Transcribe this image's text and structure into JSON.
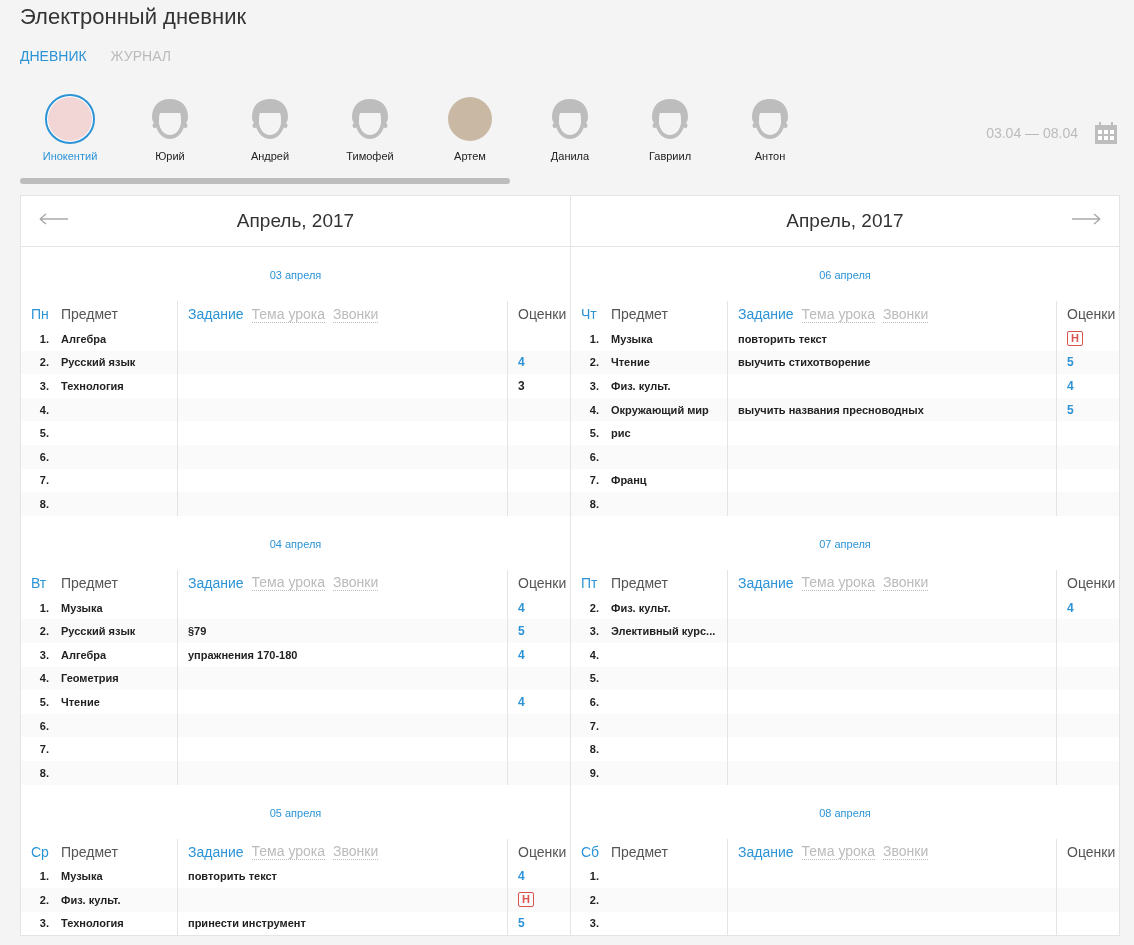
{
  "title": "Электронный дневник",
  "tabs": [
    {
      "label": "ДНЕВНИК",
      "selected": true
    },
    {
      "label": "ЖУРНАЛ",
      "selected": false
    }
  ],
  "students": [
    {
      "name": "Инокентий",
      "kind": "picture",
      "selected": true
    },
    {
      "name": "Юрий",
      "kind": "silhouette",
      "selected": false
    },
    {
      "name": "Андрей",
      "kind": "silhouette",
      "selected": false
    },
    {
      "name": "Тимофей",
      "kind": "silhouette",
      "selected": false
    },
    {
      "name": "Артем",
      "kind": "photo",
      "selected": false
    },
    {
      "name": "Данила",
      "kind": "silhouette",
      "selected": false
    },
    {
      "name": "Гавриил",
      "kind": "silhouette",
      "selected": false
    },
    {
      "name": "Антон",
      "kind": "silhouette",
      "selected": false
    }
  ],
  "date_range": "03.04 — 08.04",
  "columns": [
    {
      "month": "Апрель, 2017",
      "days": [
        {
          "date": "03 апреля",
          "weekday": "Пн",
          "header": {
            "subject": "Предмет",
            "tabs": [
              {
                "label": "Задание",
                "selected": true
              },
              {
                "label": "Тема урока",
                "selected": false
              },
              {
                "label": "Звонки",
                "selected": false
              }
            ],
            "grades": "Оценки"
          },
          "rows": [
            {
              "num": "1.",
              "subject": "Алгебра"
            },
            {
              "num": "2.",
              "subject": "Русский язык",
              "grade": {
                "kind": "mark",
                "text": "4",
                "color": "#2b93d6"
              }
            },
            {
              "num": "3.",
              "subject": "Технология",
              "grade": {
                "kind": "mark",
                "text": "3",
                "color": "#222222"
              }
            },
            {
              "num": "4."
            },
            {
              "num": "5."
            },
            {
              "num": "6."
            },
            {
              "num": "7."
            },
            {
              "num": "8."
            }
          ]
        },
        {
          "date": "04 апреля",
          "weekday": "Вт",
          "header": {
            "subject": "Предмет",
            "tabs": [
              {
                "label": "Задание",
                "selected": true
              },
              {
                "label": "Тема урока",
                "selected": false
              },
              {
                "label": "Звонки",
                "selected": false
              }
            ],
            "grades": "Оценки"
          },
          "rows": [
            {
              "num": "1.",
              "subject": "Музыка",
              "grade": {
                "kind": "mark",
                "text": "4",
                "color": "#2b93d6"
              }
            },
            {
              "num": "2.",
              "subject": "Русский язык",
              "task": "§79",
              "grade": {
                "kind": "mark",
                "text": "5",
                "color": "#2b93d6"
              }
            },
            {
              "num": "3.",
              "subject": "Алгебра",
              "task": "упражнения 170-180",
              "grade": {
                "kind": "mark",
                "text": "4",
                "color": "#2b93d6"
              }
            },
            {
              "num": "4.",
              "subject": "Геометрия"
            },
            {
              "num": "5.",
              "subject": "Чтение",
              "grade": {
                "kind": "mark",
                "text": "4",
                "color": "#2b93d6"
              }
            },
            {
              "num": "6."
            },
            {
              "num": "7."
            },
            {
              "num": "8."
            }
          ]
        },
        {
          "date": "05 апреля",
          "weekday": "Ср",
          "header": {
            "subject": "Предмет",
            "tabs": [
              {
                "label": "Задание",
                "selected": true
              },
              {
                "label": "Тема урока",
                "selected": false
              },
              {
                "label": "Звонки",
                "selected": false
              }
            ],
            "grades": "Оценки"
          },
          "rows": [
            {
              "num": "1.",
              "subject": "Музыка",
              "task": "повторить текст",
              "grade": {
                "kind": "mark",
                "text": "4",
                "color": "#2b93d6"
              }
            },
            {
              "num": "2.",
              "subject": "Физ. культ.",
              "grade": {
                "kind": "absent",
                "text": "Н",
                "color": "#d9534f"
              }
            },
            {
              "num": "3.",
              "subject": "Технология",
              "task": "принести инструмент",
              "grade": {
                "kind": "mark",
                "text": "5",
                "color": "#2b93d6"
              }
            }
          ]
        }
      ]
    },
    {
      "month": "Апрель, 2017",
      "days": [
        {
          "date": "06 апреля",
          "weekday": "Чт",
          "header": {
            "subject": "Предмет",
            "tabs": [
              {
                "label": "Задание",
                "selected": true
              },
              {
                "label": "Тема урока",
                "selected": false
              },
              {
                "label": "Звонки",
                "selected": false
              }
            ],
            "grades": "Оценки"
          },
          "rows": [
            {
              "num": "1.",
              "subject": "Музыка",
              "task": "повторить текст",
              "grade": {
                "kind": "absent",
                "text": "Н",
                "color": "#d9534f"
              }
            },
            {
              "num": "2.",
              "subject": "Чтение",
              "task": "выучить стихотворение",
              "grade": {
                "kind": "mark",
                "text": "5",
                "color": "#2b93d6"
              }
            },
            {
              "num": "3.",
              "subject": "Физ. культ.",
              "grade": {
                "kind": "mark",
                "text": "4",
                "color": "#2b93d6"
              }
            },
            {
              "num": "4.",
              "subject": "Окружающий мир",
              "task": "выучить названия пресноводных",
              "grade": {
                "kind": "mark",
                "text": "5",
                "color": "#2b93d6"
              }
            },
            {
              "num": "5.",
              "subject": "рис"
            },
            {
              "num": "6."
            },
            {
              "num": "7.",
              "subject": "Франц"
            },
            {
              "num": "8."
            }
          ]
        },
        {
          "date": "07 апреля",
          "weekday": "Пт",
          "header": {
            "subject": "Предмет",
            "tabs": [
              {
                "label": "Задание",
                "selected": true
              },
              {
                "label": "Тема урока",
                "selected": false
              },
              {
                "label": "Звонки",
                "selected": false
              }
            ],
            "grades": "Оценки"
          },
          "rows": [
            {
              "num": "2.",
              "subject": "Физ. культ.",
              "grade": {
                "kind": "mark",
                "text": "4",
                "color": "#2b93d6"
              }
            },
            {
              "num": "3.",
              "subject": "Элективный курс..."
            },
            {
              "num": "4."
            },
            {
              "num": "5."
            },
            {
              "num": "6."
            },
            {
              "num": "7."
            },
            {
              "num": "8."
            },
            {
              "num": "9."
            }
          ]
        },
        {
          "date": "08 апреля",
          "weekday": "Сб",
          "header": {
            "subject": "Предмет",
            "tabs": [
              {
                "label": "Задание",
                "selected": true
              },
              {
                "label": "Тема урока",
                "selected": false
              },
              {
                "label": "Звонки",
                "selected": false
              }
            ],
            "grades": "Оценки"
          },
          "rows": [
            {
              "num": "1."
            },
            {
              "num": "2."
            },
            {
              "num": "3."
            }
          ]
        }
      ]
    }
  ]
}
